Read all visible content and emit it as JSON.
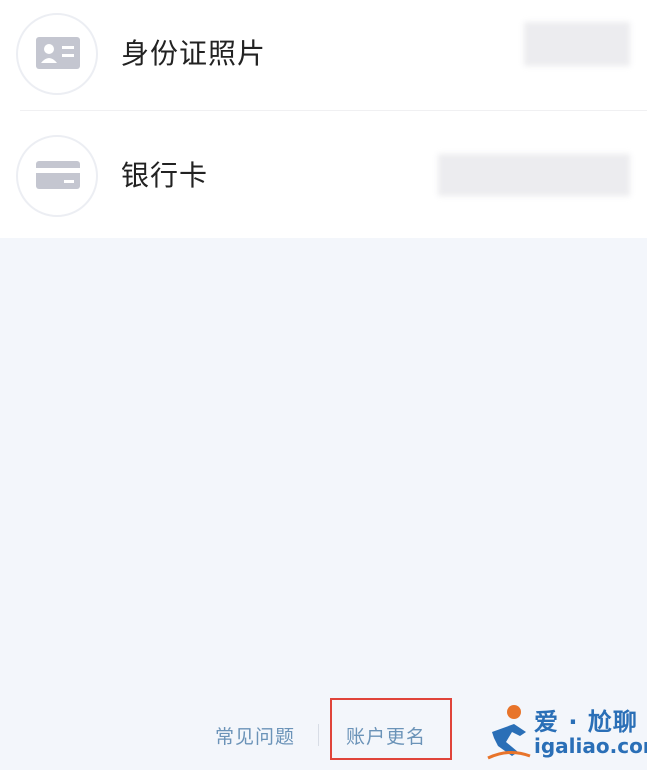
{
  "list": {
    "items": [
      {
        "label": "身份证照片",
        "icon": "id-card-icon"
      },
      {
        "label": "银行卡",
        "icon": "bank-card-icon"
      }
    ]
  },
  "footer": {
    "faq_label": "常见问题",
    "rename_label": "账户更名"
  },
  "watermark": {
    "brand": "爱 · 尬聊",
    "url": "igaliao.com"
  },
  "colors": {
    "link": "#6b93b8",
    "highlight": "#e0443a",
    "page_bg": "#f3f6fb",
    "icon_gray": "#c4c6d0"
  }
}
